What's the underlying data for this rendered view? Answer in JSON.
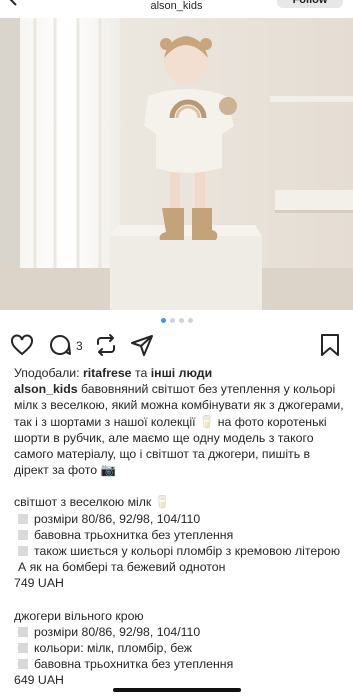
{
  "header": {
    "username": "alson_kids",
    "follow_label": "Follow"
  },
  "carousel": {
    "count": 4,
    "active_index": 0
  },
  "actions": {
    "comment_count": "3"
  },
  "likes": {
    "prefix": "Уподобали:",
    "user": "ritafrese",
    "connector": "та",
    "others": "інші люди"
  },
  "caption": {
    "author": "alson_kids",
    "intro": "бавовняний світшот без утеплення у кольорі мілк з веселкою, який можна комбінувати як з джогерами, так і з шортами з нашої колекції 🥛 на фото коротенькі шорти в рубчик, але маємо ще одну модель з такого самого матеріалу, що і світшот та джогери, пишіть в дірект за фото 📷",
    "item1": {
      "title": "світшот з веселкою мілк 🥛",
      "bullets": [
        "розміри 80/86, 92/98, 104/110",
        "бавовна трьохнитка без утеплення",
        "також шиється у кольорі пломбір з кремовою літерою А як на бомбері та бежевий однотон"
      ],
      "price": "749 UAH"
    },
    "item2": {
      "title": "джогери вільного крою",
      "bullets": [
        "розміри 80/86, 92/98, 104/110",
        "кольори: мілк, пломбір, беж",
        "бавовна трьохнитка без утеплення"
      ],
      "price": "649 UAH"
    }
  },
  "icons": {
    "back": "chevron-left-icon",
    "like": "heart-icon",
    "comment": "comment-icon",
    "repost": "repost-icon",
    "share": "send-icon",
    "save": "bookmark-icon"
  },
  "colors": {
    "accent_dot": "#3897f0",
    "text": "#262626"
  }
}
